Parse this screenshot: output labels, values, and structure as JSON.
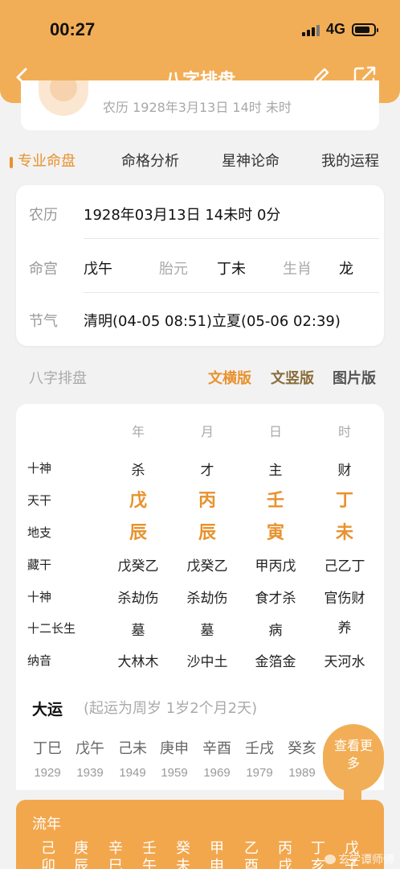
{
  "status_bar": {
    "time": "00:27",
    "network": "4G"
  },
  "nav": {
    "title": "八字排盘"
  },
  "profile": {
    "summary": "农历 1928年3月13日 14时 未时"
  },
  "tabs": [
    {
      "label": "专业命盘",
      "active": true
    },
    {
      "label": "命格分析",
      "active": false
    },
    {
      "label": "星神论命",
      "active": false
    },
    {
      "label": "我的运程",
      "active": false
    }
  ],
  "info": {
    "lunar_label": "农历",
    "lunar_value": "1928年03月13日 14未时 0分",
    "minggong_label": "命宫",
    "minggong_value": "戊午",
    "taiyuan_label": "胎元",
    "taiyuan_value": "丁未",
    "shengxiao_label": "生肖",
    "shengxiao_value": "龙",
    "jieqi_label": "节气",
    "jieqi_value": "清明(04-05 08:51)立夏(05-06 02:39)"
  },
  "bazi_section": {
    "title": "八字排盘",
    "views": [
      {
        "label": "文横版",
        "color": "#e8922e"
      },
      {
        "label": "文竖版",
        "color": "#8a6d3b"
      },
      {
        "label": "图片版",
        "color": "#555555"
      }
    ]
  },
  "bazi_table": {
    "columns": [
      "年",
      "月",
      "日",
      "时"
    ],
    "rows": [
      {
        "label": "十神",
        "cells": [
          "杀",
          "才",
          "主",
          "财"
        ]
      },
      {
        "label": "天干",
        "cells": [
          "戊",
          "丙",
          "壬",
          "丁"
        ]
      },
      {
        "label": "地支",
        "cells": [
          "辰",
          "辰",
          "寅",
          "未"
        ]
      },
      {
        "label": "藏干",
        "cells": [
          "戊癸乙",
          "戊癸乙",
          "甲丙戊",
          "己乙丁"
        ]
      },
      {
        "label": "十神",
        "cells": [
          "杀劫伤",
          "杀劫伤",
          "食才杀",
          "官伤财"
        ]
      },
      {
        "label": "十二长生",
        "cells": [
          "墓",
          "墓",
          "病",
          "养"
        ]
      },
      {
        "label": "纳音",
        "cells": [
          "大林木",
          "沙中土",
          "金箔金",
          "天河水"
        ]
      }
    ]
  },
  "dayun": {
    "title": "大运",
    "note": "(起运为周岁 1岁2个月2天)",
    "items": [
      {
        "gz": "丁巳",
        "year": "1929"
      },
      {
        "gz": "戊午",
        "year": "1939"
      },
      {
        "gz": "己未",
        "year": "1949"
      },
      {
        "gz": "庚申",
        "year": "1959"
      },
      {
        "gz": "辛酉",
        "year": "1969"
      },
      {
        "gz": "壬戌",
        "year": "1979"
      },
      {
        "gz": "癸亥",
        "year": "1989"
      }
    ],
    "more_line1": "查看更",
    "more_line2": "多"
  },
  "liunian": {
    "title": "流年",
    "items": [
      {
        "top": "己",
        "bottom": "卯"
      },
      {
        "top": "庚",
        "bottom": "辰"
      },
      {
        "top": "辛",
        "bottom": "巳"
      },
      {
        "top": "壬",
        "bottom": "午"
      },
      {
        "top": "癸",
        "bottom": "未"
      },
      {
        "top": "甲",
        "bottom": "申"
      },
      {
        "top": "乙",
        "bottom": "酉"
      },
      {
        "top": "丙",
        "bottom": "戌"
      },
      {
        "top": "丁",
        "bottom": "亥"
      },
      {
        "top": "戊",
        "bottom": "子"
      }
    ]
  },
  "watermark": "玄学谭师傅"
}
